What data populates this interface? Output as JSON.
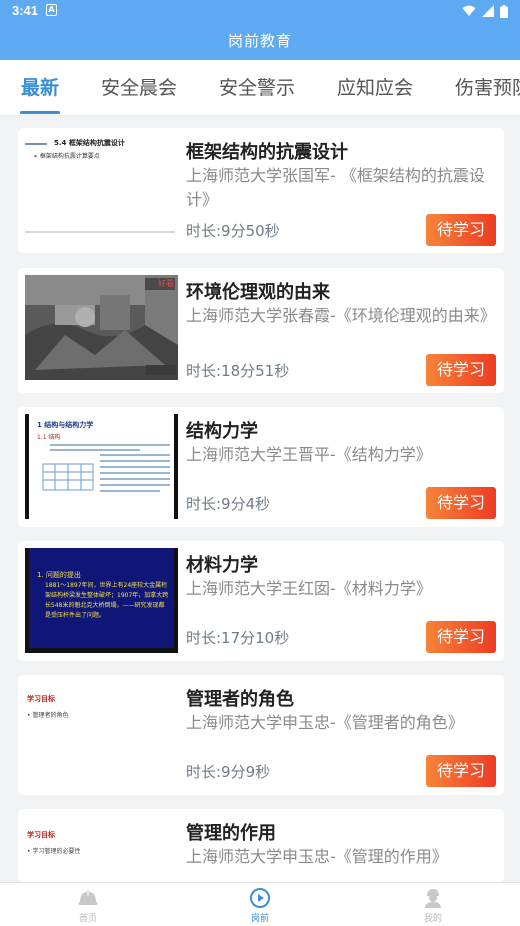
{
  "status_bar": {
    "time": "3:41",
    "notification_letter": "A"
  },
  "app_title": "岗前教育",
  "tabs": [
    {
      "label": "最新",
      "active": true
    },
    {
      "label": "安全晨会",
      "active": false
    },
    {
      "label": "安全警示",
      "active": false
    },
    {
      "label": "应知应会",
      "active": false
    },
    {
      "label": "伤害预防",
      "active": false
    }
  ],
  "courses": [
    {
      "title": "框架结构的抗震设计",
      "description": "上海师范大学张国军- 《框架结构的抗震设计》",
      "duration": "时长:9分50秒",
      "button": "待学习",
      "thumb_text": [
        "5.4 框架结构抗震设计",
        "➢ 框架结构抗震计算要点"
      ]
    },
    {
      "title": "环境伦理观的由来",
      "description": "上海师范大学张春霞-《环境伦理观的由来》",
      "duration": "时长:18分51秒",
      "button": "待学习",
      "thumb_text": [
        "好看"
      ]
    },
    {
      "title": "结构力学",
      "description": "上海师范大学王晋平-《结构力学》",
      "duration": "时长:9分4秒",
      "button": "待学习",
      "thumb_text": [
        "1  结构与结构力学",
        "1.1 结构"
      ]
    },
    {
      "title": "材料力学",
      "description": "上海师范大学王红囡-《材料力学》",
      "duration": "时长:17分10秒",
      "button": "待学习",
      "thumb_text": [
        "1. 问题的提出",
        "1881～1897年间，世界上有24座较大金属桁架结构桥梁发生整体破坏；1907年，加拿大跨长548米的魁北克大桥倒塌，——研究发现都是受压杆件出了问题。"
      ]
    },
    {
      "title": "管理者的角色",
      "description": "上海师范大学申玉忠-《管理者的角色》",
      "duration": "时长:9分9秒",
      "button": "待学习",
      "thumb_text": [
        "学习目标",
        "• 管理者的角色"
      ]
    },
    {
      "title": "管理的作用",
      "description": "上海师范大学申玉忠-《管理的作用》",
      "duration": "",
      "button": "",
      "thumb_text": [
        "学习目标",
        "• 学习管理的必要性"
      ]
    }
  ],
  "bottom_nav": [
    {
      "label": "首页",
      "icon": "helmet-icon",
      "active": false
    },
    {
      "label": "岗前",
      "icon": "play-icon",
      "active": true
    },
    {
      "label": "我的",
      "icon": "worker-icon",
      "active": false
    }
  ],
  "colors": {
    "header": "#5eaaf2",
    "accent": "#3b8fd9",
    "button_start": "#f7843a",
    "button_end": "#ee3b23"
  }
}
